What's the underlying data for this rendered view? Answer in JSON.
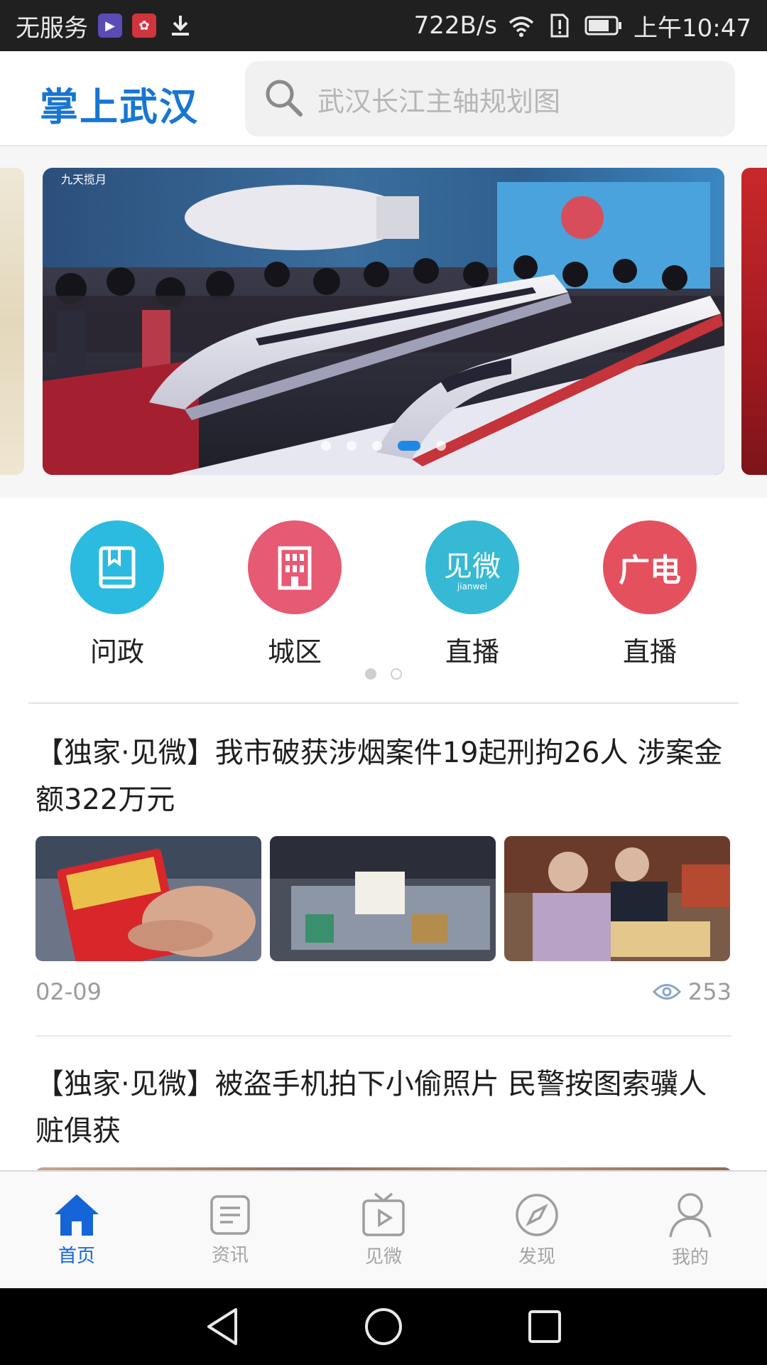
{
  "status_bar": {
    "carrier": "无服务",
    "speed": "722B/s",
    "time": "上午10:47"
  },
  "header": {
    "logo": "掌上武汉",
    "search_placeholder": "武汉长江主轴规划图"
  },
  "banner": {
    "slide_count": 5,
    "active_index": 3,
    "overlay_text": "九天揽月"
  },
  "quick_entries": [
    {
      "label": "问政",
      "icon": "book-icon",
      "color": "#2cbbe0"
    },
    {
      "label": "城区",
      "icon": "building-icon",
      "color": "#e65a73"
    },
    {
      "label": "直播",
      "icon": "jianwei-logo",
      "color": "#36b9d4",
      "logo_text": "见微",
      "logo_sub": "jianwei"
    },
    {
      "label": "直播",
      "icon": "guangdian-logo",
      "color": "#e5505e",
      "logo_text": "广电"
    }
  ],
  "quick_pager": {
    "pages": 2,
    "active": 0
  },
  "news": [
    {
      "title": "【独家·见微】我市破获涉烟案件19起刑拘26人 涉案金额322万元",
      "date": "02-09",
      "views": "253"
    },
    {
      "title": "【独家·见微】被盗手机拍下小偷照片 民警按图索骥人赃俱获"
    }
  ],
  "tabs": [
    {
      "label": "首页",
      "icon": "home-icon",
      "active": true
    },
    {
      "label": "资讯",
      "icon": "news-icon",
      "active": false
    },
    {
      "label": "见微",
      "icon": "tv-icon",
      "active": false
    },
    {
      "label": "发现",
      "icon": "compass-icon",
      "active": false
    },
    {
      "label": "我的",
      "icon": "user-icon",
      "active": false
    }
  ],
  "colors": {
    "brand_blue": "#1876d3",
    "tab_active": "#1565d8"
  }
}
